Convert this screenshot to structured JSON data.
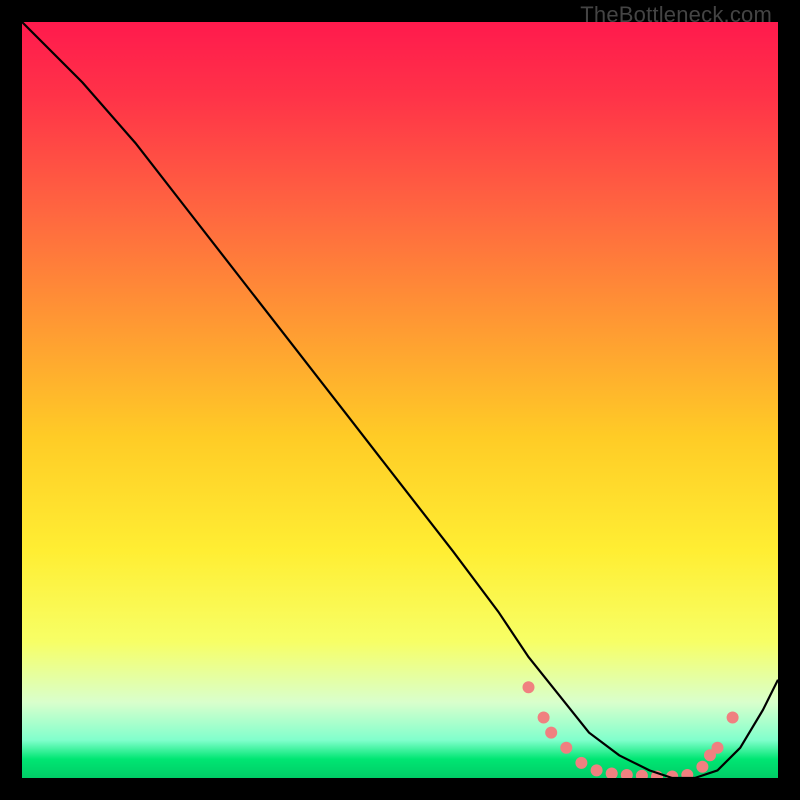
{
  "watermark": "TheBottleneck.com",
  "chart_data": {
    "type": "line",
    "title": "",
    "xlabel": "",
    "ylabel": "",
    "xlim": [
      0,
      100
    ],
    "ylim": [
      0,
      100
    ],
    "grid": false,
    "legend": false,
    "gradient_stops": [
      {
        "offset": 0.0,
        "color": "#ff1a4d"
      },
      {
        "offset": 0.1,
        "color": "#ff3348"
      },
      {
        "offset": 0.25,
        "color": "#ff6640"
      },
      {
        "offset": 0.4,
        "color": "#ff9933"
      },
      {
        "offset": 0.55,
        "color": "#ffcc26"
      },
      {
        "offset": 0.7,
        "color": "#ffee33"
      },
      {
        "offset": 0.82,
        "color": "#f7ff66"
      },
      {
        "offset": 0.9,
        "color": "#d9ffcc"
      },
      {
        "offset": 0.95,
        "color": "#80ffcc"
      },
      {
        "offset": 0.975,
        "color": "#00e673"
      },
      {
        "offset": 1.0,
        "color": "#00cc66"
      }
    ],
    "series": [
      {
        "name": "curve",
        "color": "#000000",
        "x": [
          0,
          8,
          15,
          22,
          29,
          36,
          43,
          50,
          57,
          63,
          67,
          71,
          75,
          79,
          83,
          86,
          89,
          92,
          95,
          98,
          100
        ],
        "y": [
          100,
          92,
          84,
          75,
          66,
          57,
          48,
          39,
          30,
          22,
          16,
          11,
          6,
          3,
          1,
          0,
          0,
          1,
          4,
          9,
          13
        ]
      }
    ],
    "markers": {
      "color": "#f08080",
      "points": [
        {
          "x": 67,
          "y": 12
        },
        {
          "x": 69,
          "y": 8
        },
        {
          "x": 70,
          "y": 6
        },
        {
          "x": 72,
          "y": 4
        },
        {
          "x": 74,
          "y": 2
        },
        {
          "x": 76,
          "y": 1
        },
        {
          "x": 78,
          "y": 0.6
        },
        {
          "x": 80,
          "y": 0.4
        },
        {
          "x": 82,
          "y": 0.3
        },
        {
          "x": 84,
          "y": 0.2
        },
        {
          "x": 86,
          "y": 0.2
        },
        {
          "x": 88,
          "y": 0.4
        },
        {
          "x": 90,
          "y": 1.5
        },
        {
          "x": 91,
          "y": 3
        },
        {
          "x": 92,
          "y": 4
        },
        {
          "x": 94,
          "y": 8
        }
      ]
    }
  }
}
